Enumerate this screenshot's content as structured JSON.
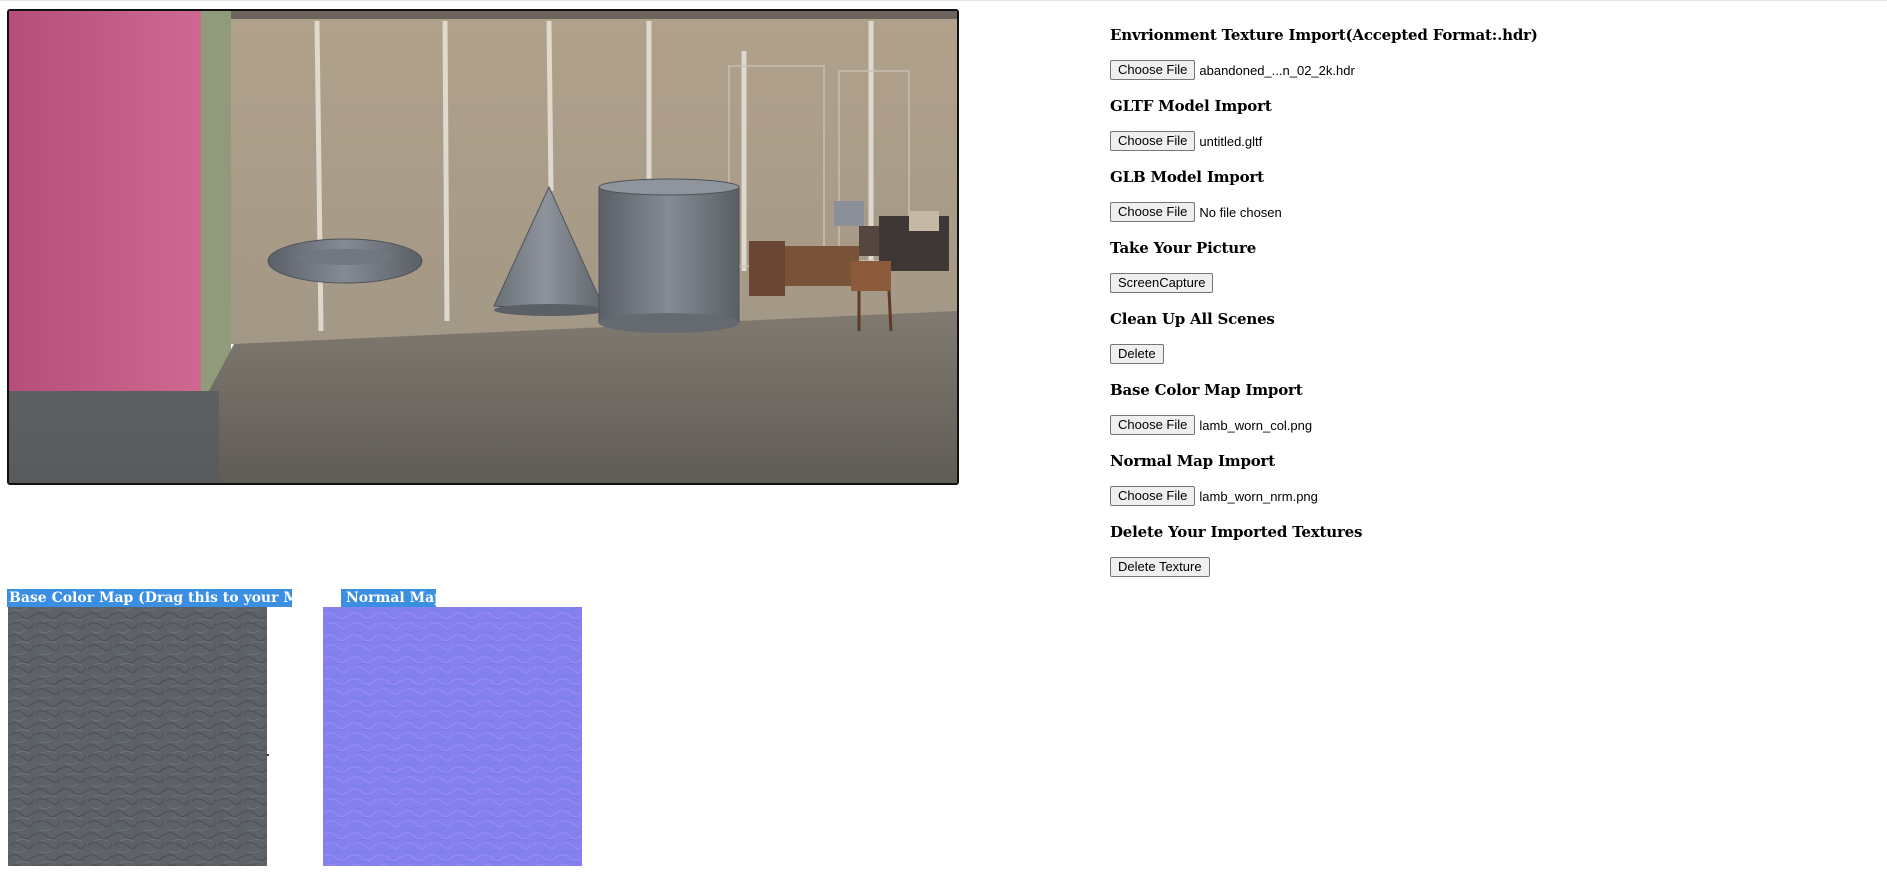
{
  "viewport": {
    "scene_objects": [
      "torus",
      "cone",
      "cylinder"
    ],
    "environment": "abandoned warehouse HDR environment"
  },
  "controls": [
    {
      "heading": "Envrionment Texture Import(Accepted Format:.hdr)",
      "button": "Choose File",
      "file": "abandoned_...n_02_2k.hdr"
    },
    {
      "heading": "GLTF Model Import",
      "button": "Choose File",
      "file": "untitled.gltf"
    },
    {
      "heading": "GLB Model Import",
      "button": "Choose File",
      "file": "No file chosen"
    },
    {
      "heading": "Take Your Picture",
      "button": "ScreenCapture"
    },
    {
      "heading": "Clean Up All Scenes",
      "button": "Delete"
    },
    {
      "heading": "Base Color Map Import",
      "button": "Choose File",
      "file": "lamb_worn_col.png"
    },
    {
      "heading": "Normal Map Import",
      "button": "Choose File",
      "file": "lamb_worn_nrm.png"
    },
    {
      "heading": "Delete Your Imported Textures",
      "button": "Delete Texture"
    }
  ],
  "textures": {
    "base_color": {
      "label": "Base Color Map (Drag this to your Mesh)",
      "color": "#5d6266"
    },
    "normal": {
      "label": "Normal Map",
      "color": "#8481ef"
    }
  },
  "colors": {
    "label_bg": "#3b8fe2",
    "wall_pink": "#c2577f",
    "wall_beige": "#b4a58f",
    "floor": "#6e6a63"
  }
}
